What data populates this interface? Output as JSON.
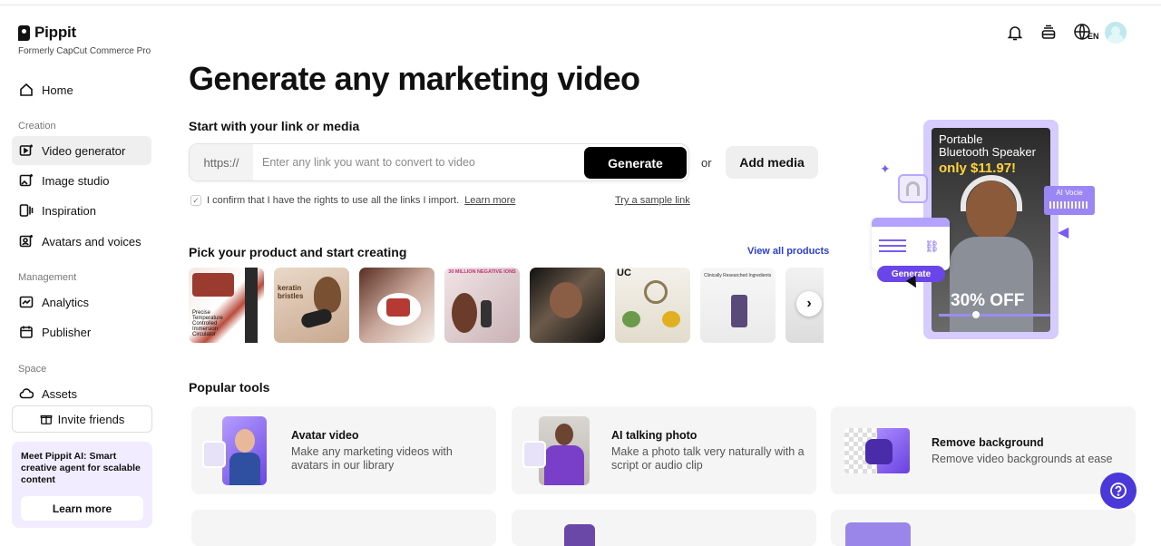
{
  "brand": {
    "name": "Pippit",
    "subtitle": "Formerly CapCut Commerce Pro"
  },
  "sidebar": {
    "home": "Home",
    "sections": {
      "creation": "Creation",
      "management": "Management",
      "space": "Space"
    },
    "creation_items": [
      "Video generator",
      "Image studio",
      "Inspiration",
      "Avatars and voices"
    ],
    "management_items": [
      "Analytics",
      "Publisher"
    ],
    "space_items": [
      "Assets"
    ],
    "invite": "Invite friends",
    "promo": {
      "text": "Meet Pippit AI: Smart creative agent for scalable content",
      "button": "Learn more"
    }
  },
  "header": {
    "language": "EN"
  },
  "main": {
    "title": "Generate any marketing video",
    "link_section": "Start with your link or media",
    "prefix": "https://",
    "placeholder": "Enter any link you want to convert to video",
    "generate": "Generate",
    "or": "or",
    "add_media": "Add media",
    "confirm_text": "I confirm that I have the rights to use all the links I import.",
    "learn_more": "Learn more",
    "try_sample": "Try a sample link",
    "products_heading": "Pick your product and start creating",
    "view_all": "View all products",
    "products": [
      {
        "caption": "Precise Temperature Controlled Immersion Circulator"
      },
      {
        "caption": "keratin bristles"
      },
      {
        "caption": ""
      },
      {
        "caption": "30 MILLION NEGATIVE IONS"
      },
      {
        "caption": ""
      },
      {
        "caption": "UC"
      },
      {
        "caption": "Clinically Researched Ingredients"
      },
      {
        "caption": ""
      }
    ],
    "popular_heading": "Popular tools",
    "tools": [
      {
        "title": "Avatar video",
        "desc": "Make any marketing videos with avatars in our library"
      },
      {
        "title": "AI talking photo",
        "desc": "Make a photo talk very naturally with a script or audio clip"
      },
      {
        "title": "Remove background",
        "desc": "Remove video backgrounds at ease"
      }
    ]
  },
  "hero": {
    "line1": "Portable",
    "line2": "Bluetooth Speaker",
    "price": "only $11.97!",
    "discount": "30% OFF",
    "badge": "AI Vocie",
    "button": "Generate"
  },
  "colors": {
    "accent": "#4b38d8",
    "purple_light": "#d7ccff",
    "link_blue": "#2b3fd6"
  }
}
